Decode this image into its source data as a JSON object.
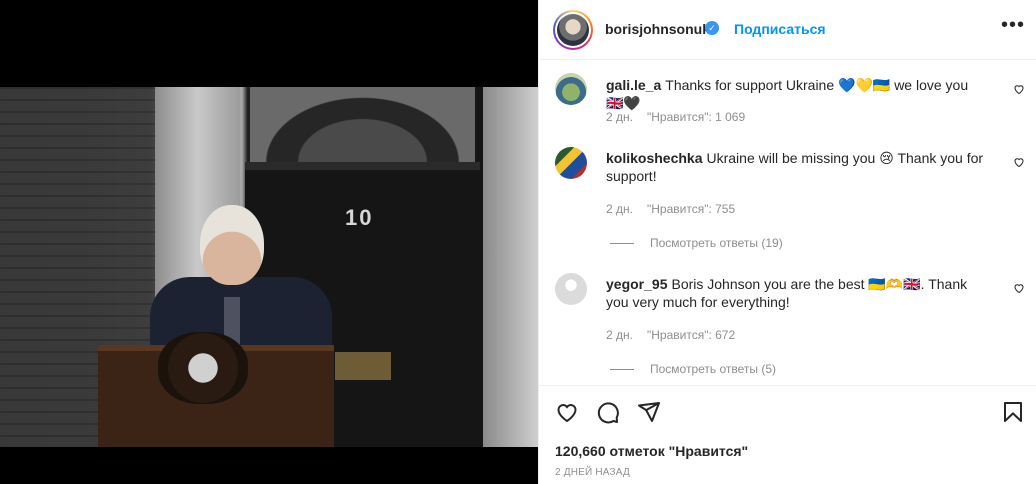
{
  "post": {
    "photo_alt": "",
    "door_number": "10"
  },
  "header": {
    "username": "borisjohnsonuk",
    "verified_glyph": "✓",
    "subscribe_label": "Подписаться",
    "more_label": "•••"
  },
  "comments": [
    {
      "username": "gali.le_a",
      "text": "Thanks for support Ukraine 💙💛🇺🇦 we love you 🇬🇧🖤",
      "age": "2 дн.",
      "likes": "\"Нравится\": 1 069",
      "replies": ""
    },
    {
      "username": "kolikoshechka",
      "text": "Ukraine will be missing you 😢 Thank you for support!",
      "age": "2 дн.",
      "likes": "\"Нравится\": 755",
      "replies": "Посмотреть ответы (19)"
    },
    {
      "username": "yegor_95",
      "text": "Boris Johnson you are the best 🇺🇦🫶🇬🇧. Thank you very much for everything!",
      "age": "2 дн.",
      "likes": "\"Нравится\": 672",
      "replies": "Посмотреть ответы (5)"
    }
  ],
  "footer": {
    "likes_count": "120,660 отметок \"Нравится\"",
    "posted_ago": "2 ДНЕЙ НАЗАД"
  },
  "icons": {
    "like": "heart-icon",
    "comment": "comment-icon",
    "share": "share-icon",
    "save": "bookmark-icon",
    "comment_like": "heart-small-icon"
  },
  "colors": {
    "accent": "#0095f6",
    "verified": "#3897f0",
    "muted": "#8e8e8e",
    "text": "#262626"
  }
}
